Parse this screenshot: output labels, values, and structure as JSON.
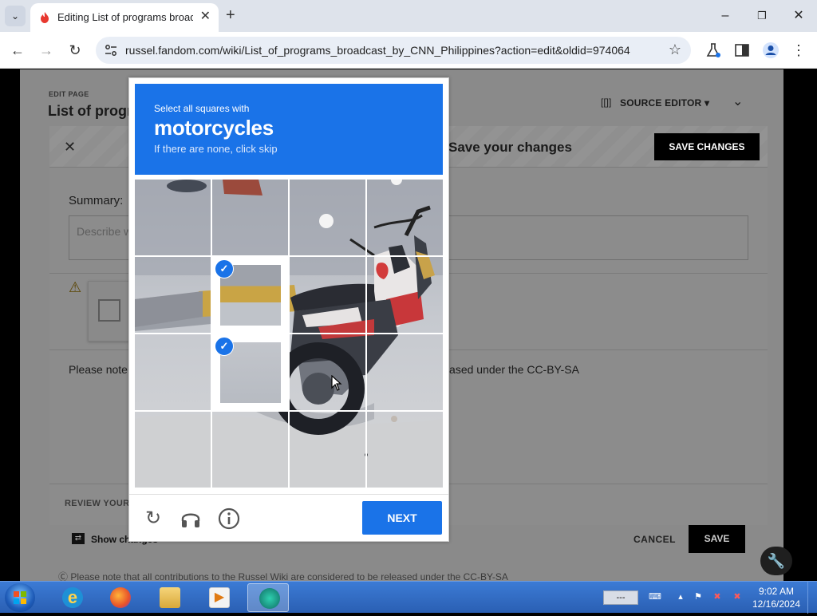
{
  "browser": {
    "tab_title": "Editing List of programs broadcast by CNN Philippines",
    "url": "russel.fandom.com/wiki/List_of_programs_broadcast_by_CNN_Philippines?action=edit&oldid=974064",
    "win_minimize": "–",
    "win_maximize": "❐",
    "win_close": "✕",
    "tab_close": "✕",
    "new_tab": "+",
    "back": "←",
    "forward": "→",
    "reload": "↻",
    "star": "☆",
    "menu": "⋮"
  },
  "page": {
    "edit_page_label": "EDIT PAGE",
    "heading": "List of programs broadcast by CNN Philippines",
    "source_editor": "SOURCE EDITOR",
    "dialog_title": "Save your changes",
    "save_changes": "SAVE CHANGES",
    "summary_label": "Summary:",
    "summary_placeholder": "Describe what you changed",
    "please_note": "Please note that all contributions to the Russel Wiki are considered to be released under the CC-BY-SA",
    "review_label": "REVIEW YOUR CHANGES",
    "show_changes": "Show changes",
    "cancel": "CANCEL",
    "save": "SAVE",
    "footer_note": "Please note that all contributions to the Russel Wiki are considered to be released under the CC-BY-SA"
  },
  "captcha": {
    "instruction": "Select all squares with",
    "target": "motorcycles",
    "skip_hint": "If there are none, click skip",
    "next_label": "NEXT",
    "selected_tiles": [
      5,
      9
    ],
    "check_glyph": "✓",
    "reload_glyph": "↻",
    "audio_glyph": "🎧",
    "info_glyph": "ⓘ",
    "accent_color": "#1a73e8"
  },
  "taskbar": {
    "apps": [
      "internet-explorer",
      "firefox",
      "file-explorer",
      "media-player",
      "active-app"
    ],
    "lang": "---",
    "time": "9:02 AM",
    "date": "12/16/2024"
  }
}
